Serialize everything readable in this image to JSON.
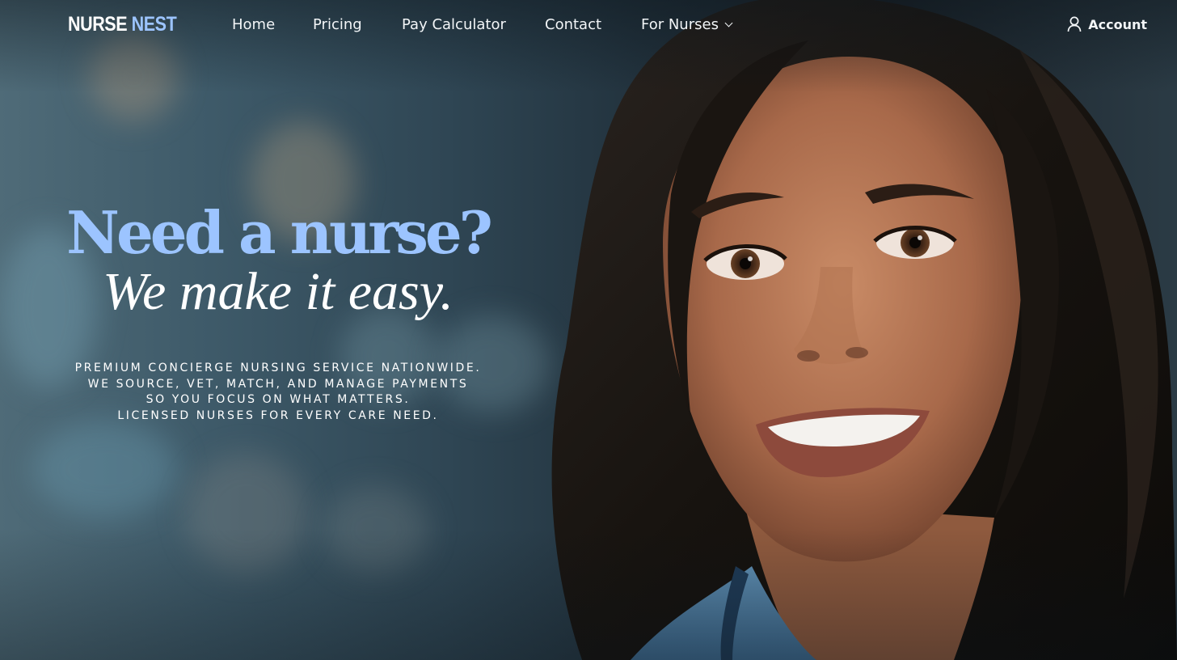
{
  "brand": {
    "logo_part1": "NURSE",
    "logo_part2": "NEST",
    "accent_color": "#9cc4ff"
  },
  "nav": {
    "links": [
      {
        "label": "Home"
      },
      {
        "label": "Pricing"
      },
      {
        "label": "Pay Calculator"
      },
      {
        "label": "Contact"
      },
      {
        "label": "For Nurses",
        "icon": "chevron-down-icon"
      }
    ],
    "account_label": "Account",
    "account_icon": "user-icon"
  },
  "hero": {
    "headline": "Need a nurse?",
    "subheadline": "We make it easy.",
    "tagline_lines": [
      "PREMIUM CONCIERGE NURSING SERVICE NATIONWIDE.",
      "WE SOURCE, VET, MATCH, AND MANAGE PAYMENTS",
      "SO YOU FOCUS ON WHAT MATTERS.",
      "LICENSED NURSES FOR EVERY CARE NEED."
    ],
    "image": "smiling-nurse-portrait"
  }
}
